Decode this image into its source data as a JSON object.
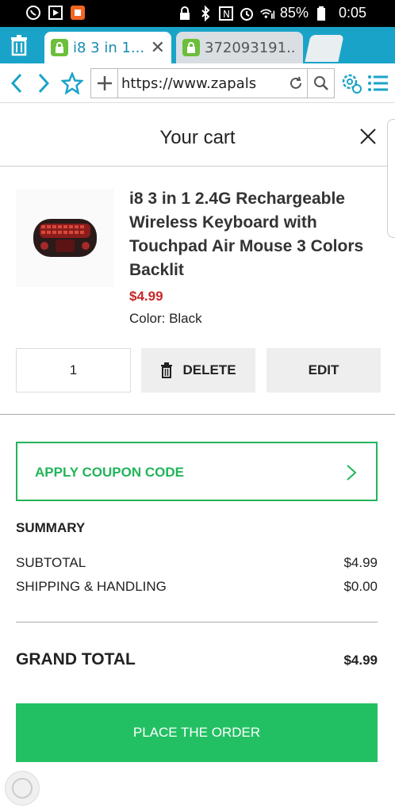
{
  "status_bar": {
    "battery_percent": "85%",
    "time": "0:05"
  },
  "browser": {
    "tabs": [
      {
        "label": "i8 3 in 1...",
        "active": true
      },
      {
        "label": "372093191...",
        "active": false
      }
    ],
    "url": "https://www.zapals",
    "accent_color": "#1aa3c8"
  },
  "cart": {
    "title": "Your cart",
    "item": {
      "name": "i8 3 in 1 2.4G Rechargeable Wireless Keyboard with Touchpad Air Mouse 3 Colors Backlit",
      "price": "$4.99",
      "color_label": "Color: Black",
      "quantity": "1",
      "delete_label": "DELETE",
      "edit_label": "EDIT"
    },
    "coupon_label": "APPLY COUPON CODE",
    "summary": {
      "title": "SUMMARY",
      "subtotal_label": "SUBTOTAL",
      "subtotal_value": "$4.99",
      "shipping_label": "SHIPPING & HANDLING",
      "shipping_value": "$0.00",
      "grand_total_label": "GRAND TOTAL",
      "grand_total_value": "$4.99"
    },
    "place_order_label": "PLACE THE ORDER",
    "colors": {
      "price": "#c62828",
      "brand_green": "#22c063"
    }
  }
}
